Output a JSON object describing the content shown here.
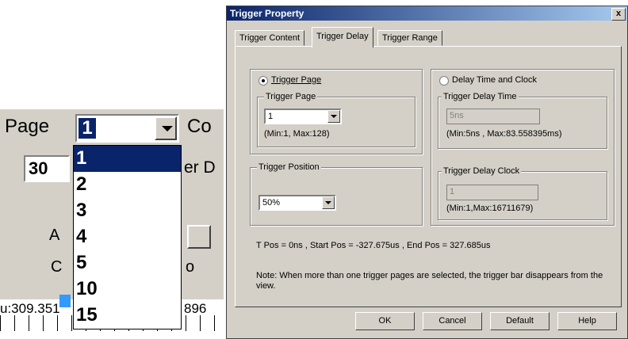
{
  "zoom": {
    "page_label": "Page",
    "co_label": "Co",
    "page_value": "1",
    "edit_value": "30",
    "er_label": "er D",
    "a_label": "A",
    "c_label": "C",
    "o_label": "o",
    "ruler_left": "u:309.351",
    "ruler_right": "896",
    "dropdown_items": [
      "1",
      "2",
      "3",
      "4",
      "5",
      "10",
      "15"
    ],
    "selected_item": "1"
  },
  "dialog": {
    "title": "Trigger Property",
    "close": "x",
    "tabs": [
      "Trigger Content",
      "Trigger Delay",
      "Trigger Range"
    ],
    "active_tab": "Trigger Delay",
    "trigger_page_radio": "Trigger Page",
    "trigger_page_group": "Trigger Page",
    "trigger_page_value": "1",
    "trigger_page_range": "(Min:1, Max:128)",
    "trigger_position_group": "Trigger Position",
    "trigger_position_value": "50%",
    "delay_time_clock_radio": "Delay Time and Clock",
    "delay_time_group": "Trigger Delay Time",
    "delay_time_value": "5ns",
    "delay_time_range": "(Min:5ns , Max:83.558395ms)",
    "delay_clock_group": "Trigger Delay Clock",
    "delay_clock_value": "1",
    "delay_clock_range": "(Min:1,Max:16711679)",
    "pos_info": "T Pos = 0ns , Start Pos = -327.675us , End Pos = 327.685us",
    "note": "Note: When more than one trigger pages are selected, the trigger bar disappears from the view.",
    "buttons": {
      "ok": "OK",
      "cancel": "Cancel",
      "default": "Default",
      "help": "Help"
    }
  }
}
